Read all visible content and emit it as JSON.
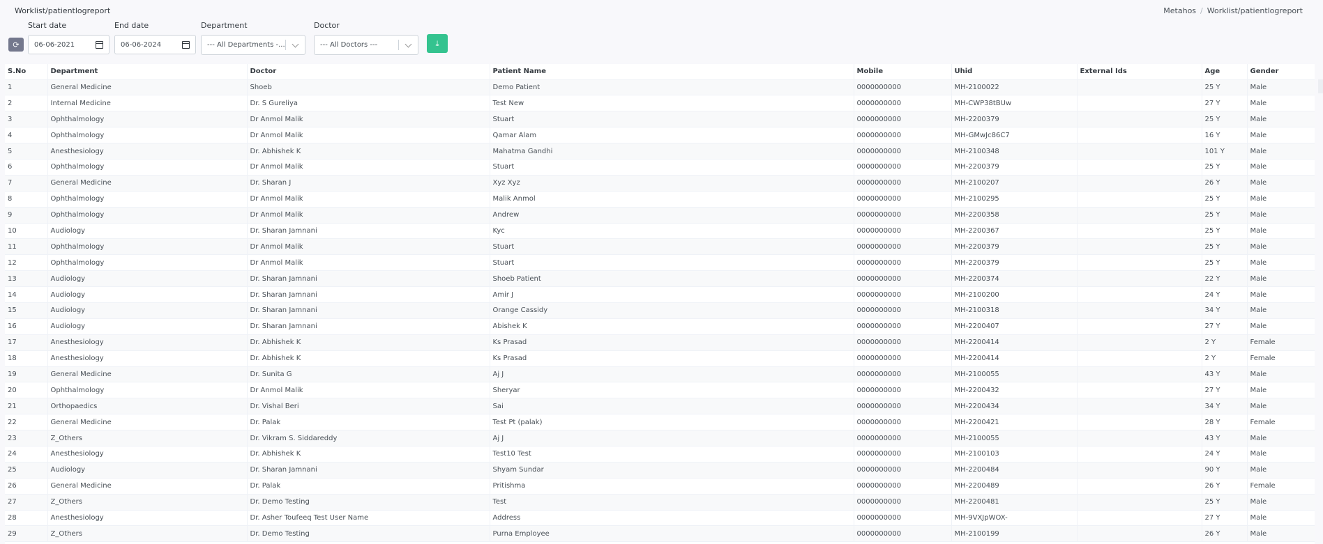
{
  "header": {
    "page_title": "Worklist/patientlogreport",
    "breadcrumb": [
      "Metahos",
      "/",
      "Worklist/patientlogreport"
    ]
  },
  "filters": {
    "start_date_label": "Start date",
    "start_date_value": "06-06-2021",
    "end_date_label": "End date",
    "end_date_value": "06-06-2024",
    "department_label": "Department",
    "department_value": "--- All Departments -...",
    "doctor_label": "Doctor",
    "doctor_value": "--- All Doctors ---",
    "refresh_icon": "⟳",
    "download_icon": "⤓"
  },
  "table": {
    "columns": [
      "S.No",
      "Department",
      "Doctor",
      "Patient Name",
      "Mobile",
      "Uhid",
      "External Ids",
      "Age",
      "Gender"
    ],
    "rows": [
      [
        "1",
        "General Medicine",
        "Shoeb",
        "Demo Patient",
        "0000000000",
        "MH-2100022",
        "",
        "25 Y",
        "Male"
      ],
      [
        "2",
        "Internal Medicine",
        "Dr. S Gureliya",
        "Test New",
        "0000000000",
        "MH-CWP38tBUw",
        "",
        "27 Y",
        "Male"
      ],
      [
        "3",
        "Ophthalmology",
        "Dr Anmol Malik",
        "Stuart",
        "0000000000",
        "MH-2200379",
        "",
        "25 Y",
        "Male"
      ],
      [
        "4",
        "Ophthalmology",
        "Dr Anmol Malik",
        "Qamar Alam",
        "0000000000",
        "MH-GMwJc86C7",
        "",
        "16 Y",
        "Male"
      ],
      [
        "5",
        "Anesthesiology",
        "Dr. Abhishek K",
        "Mahatma Gandhi",
        "0000000000",
        "MH-2100348",
        "",
        "101 Y",
        "Male"
      ],
      [
        "6",
        "Ophthalmology",
        "Dr Anmol Malik",
        "Stuart",
        "0000000000",
        "MH-2200379",
        "",
        "25 Y",
        "Male"
      ],
      [
        "7",
        "General Medicine",
        "Dr. Sharan J",
        "Xyz Xyz",
        "0000000000",
        "MH-2100207",
        "",
        "26 Y",
        "Male"
      ],
      [
        "8",
        "Ophthalmology",
        "Dr Anmol Malik",
        "Malik Anmol",
        "0000000000",
        "MH-2100295",
        "",
        "25 Y",
        "Male"
      ],
      [
        "9",
        "Ophthalmology",
        "Dr Anmol Malik",
        "Andrew",
        "0000000000",
        "MH-2200358",
        "",
        "25 Y",
        "Male"
      ],
      [
        "10",
        "Audiology",
        "Dr. Sharan Jamnani",
        "Kyc",
        "0000000000",
        "MH-2200367",
        "",
        "25 Y",
        "Male"
      ],
      [
        "11",
        "Ophthalmology",
        "Dr Anmol Malik",
        "Stuart",
        "0000000000",
        "MH-2200379",
        "",
        "25 Y",
        "Male"
      ],
      [
        "12",
        "Ophthalmology",
        "Dr Anmol Malik",
        "Stuart",
        "0000000000",
        "MH-2200379",
        "",
        "25 Y",
        "Male"
      ],
      [
        "13",
        "Audiology",
        "Dr. Sharan Jamnani",
        "Shoeb Patient",
        "0000000000",
        "MH-2200374",
        "",
        "22 Y",
        "Male"
      ],
      [
        "14",
        "Audiology",
        "Dr. Sharan Jamnani",
        "Amir J",
        "0000000000",
        "MH-2100200",
        "",
        "24 Y",
        "Male"
      ],
      [
        "15",
        "Audiology",
        "Dr. Sharan Jamnani",
        "Orange Cassidy",
        "0000000000",
        "MH-2100318",
        "",
        "34 Y",
        "Male"
      ],
      [
        "16",
        "Audiology",
        "Dr. Sharan Jamnani",
        "Abishek K",
        "0000000000",
        "MH-2200407",
        "",
        "27 Y",
        "Male"
      ],
      [
        "17",
        "Anesthesiology",
        "Dr. Abhishek K",
        "Ks Prasad",
        "0000000000",
        "MH-2200414",
        "",
        "2 Y",
        "Female"
      ],
      [
        "18",
        "Anesthesiology",
        "Dr. Abhishek K",
        "Ks Prasad",
        "0000000000",
        "MH-2200414",
        "",
        "2 Y",
        "Female"
      ],
      [
        "19",
        "General Medicine",
        "Dr. Sunita G",
        "Aj J",
        "0000000000",
        "MH-2100055",
        "",
        "43 Y",
        "Male"
      ],
      [
        "20",
        "Ophthalmology",
        "Dr Anmol Malik",
        "Sheryar",
        "0000000000",
        "MH-2200432",
        "",
        "27 Y",
        "Male"
      ],
      [
        "21",
        "Orthopaedics",
        "Dr. Vishal Beri",
        "Sai",
        "0000000000",
        "MH-2200434",
        "",
        "34 Y",
        "Male"
      ],
      [
        "22",
        "General Medicine",
        "Dr. Palak",
        "Test Pt (palak)",
        "0000000000",
        "MH-2200421",
        "",
        "28 Y",
        "Female"
      ],
      [
        "23",
        "Z_Others",
        "Dr. Vikram S. Siddareddy",
        "Aj J",
        "0000000000",
        "MH-2100055",
        "",
        "43 Y",
        "Male"
      ],
      [
        "24",
        "Anesthesiology",
        "Dr. Abhishek K",
        "Test10 Test",
        "0000000000",
        "MH-2100103",
        "",
        "24 Y",
        "Male"
      ],
      [
        "25",
        "Audiology",
        "Dr. Sharan Jamnani",
        "Shyam Sundar",
        "0000000000",
        "MH-2200484",
        "",
        "90 Y",
        "Male"
      ],
      [
        "26",
        "General Medicine",
        "Dr. Palak",
        "Pritishma",
        "0000000000",
        "MH-2200489",
        "",
        "26 Y",
        "Female"
      ],
      [
        "27",
        "Z_Others",
        "Dr. Demo Testing",
        "Test",
        "0000000000",
        "MH-2200481",
        "",
        "25 Y",
        "Male"
      ],
      [
        "28",
        "Anesthesiology",
        "Dr. Asher Toufeeq Test User Name",
        "Address",
        "0000000000",
        "MH-9VXJpWOX-",
        "",
        "27 Y",
        "Male"
      ],
      [
        "29",
        "Z_Others",
        "Dr. Demo Testing",
        "Purna Employee",
        "0000000000",
        "MH-2100199",
        "",
        "26 Y",
        "Male"
      ]
    ]
  }
}
